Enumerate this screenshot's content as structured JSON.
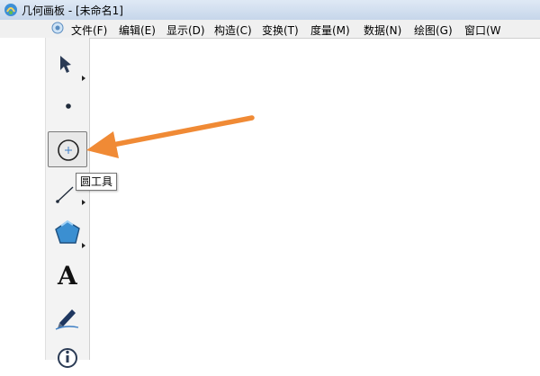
{
  "window": {
    "title": "几何画板 - [未命名1]"
  },
  "menu": {
    "items": [
      {
        "label": "文件(F)"
      },
      {
        "label": "编辑(E)"
      },
      {
        "label": "显示(D)"
      },
      {
        "label": "构造(C)"
      },
      {
        "label": "变换(T)"
      },
      {
        "label": "度量(M)"
      },
      {
        "label": "数据(N)"
      },
      {
        "label": "绘图(G)"
      },
      {
        "label": "窗口(W"
      }
    ]
  },
  "toolbar": {
    "tools": [
      {
        "icon": "arrow-select-icon"
      },
      {
        "icon": "point-icon"
      },
      {
        "icon": "circle-tool-icon",
        "selected": true
      },
      {
        "icon": "line-segment-icon"
      },
      {
        "icon": "polygon-icon"
      },
      {
        "icon": "text-tool-icon",
        "glyph": "A"
      },
      {
        "icon": "marker-pen-icon"
      },
      {
        "icon": "info-icon"
      }
    ]
  },
  "tooltip": {
    "text": "圆工具"
  },
  "colors": {
    "arrow": "#f08a35",
    "polygon": "#3b8fd1",
    "toolbar_bg": "#f3f3f3",
    "menubar_bg": "#f0f0f0"
  }
}
